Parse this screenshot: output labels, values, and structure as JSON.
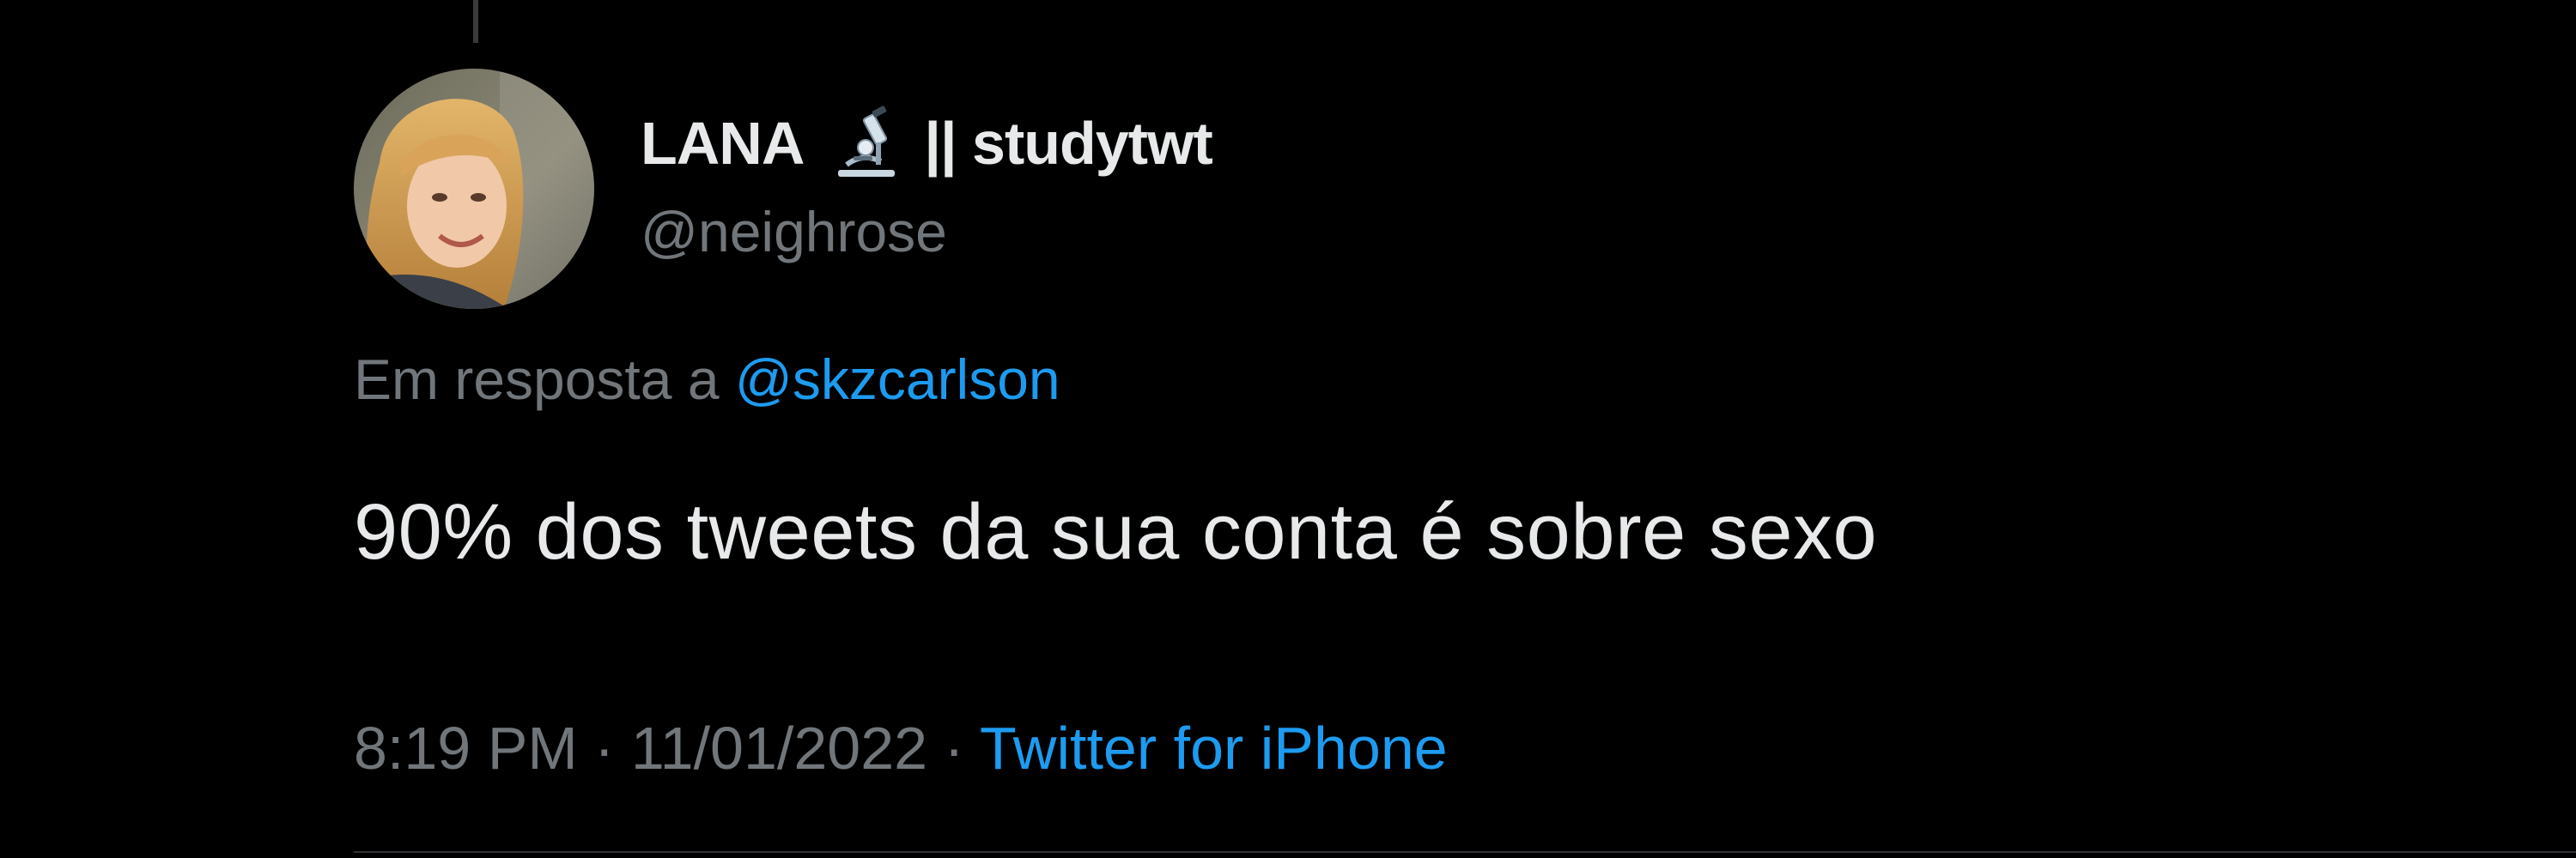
{
  "author": {
    "name": "LANA",
    "name_emoji": "microscope-icon",
    "name_suffix": "|| studytwt",
    "handle": "@neighrose"
  },
  "reply": {
    "prefix": "Em resposta a ",
    "mention": "@skzcarlson"
  },
  "tweet": {
    "text": "90% dos tweets da sua conta é sobre sexo"
  },
  "meta": {
    "time": "8:19 PM",
    "separator": " · ",
    "date": "11/01/2022",
    "source": "Twitter for iPhone"
  },
  "colors": {
    "background": "#000000",
    "primary_text": "#e7e9ea",
    "secondary_text": "#71767b",
    "link": "#1d9bf0"
  }
}
